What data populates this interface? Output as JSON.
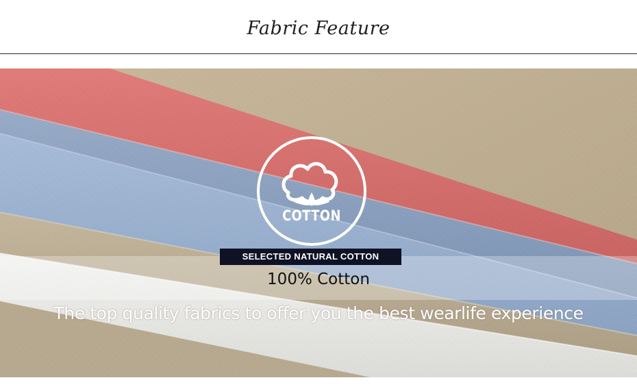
{
  "header": {
    "title": "Fabric Feature"
  },
  "badge": {
    "label": "COTTON",
    "icon": "cotton-flower-icon"
  },
  "tag": {
    "text": "SELECTED NATURAL COTTON"
  },
  "material": {
    "text": "100% Cotton"
  },
  "tagline": {
    "text": "The top quality fabrics to offer you the best wearlife experience"
  },
  "colors": {
    "background": "#ffffff",
    "tag_bg": "#0f1224",
    "fabric_red": "#d86e6c",
    "fabric_blue": "#8ea6c6",
    "fabric_khaki": "#b8aa92",
    "fabric_white": "#eeeeee"
  }
}
